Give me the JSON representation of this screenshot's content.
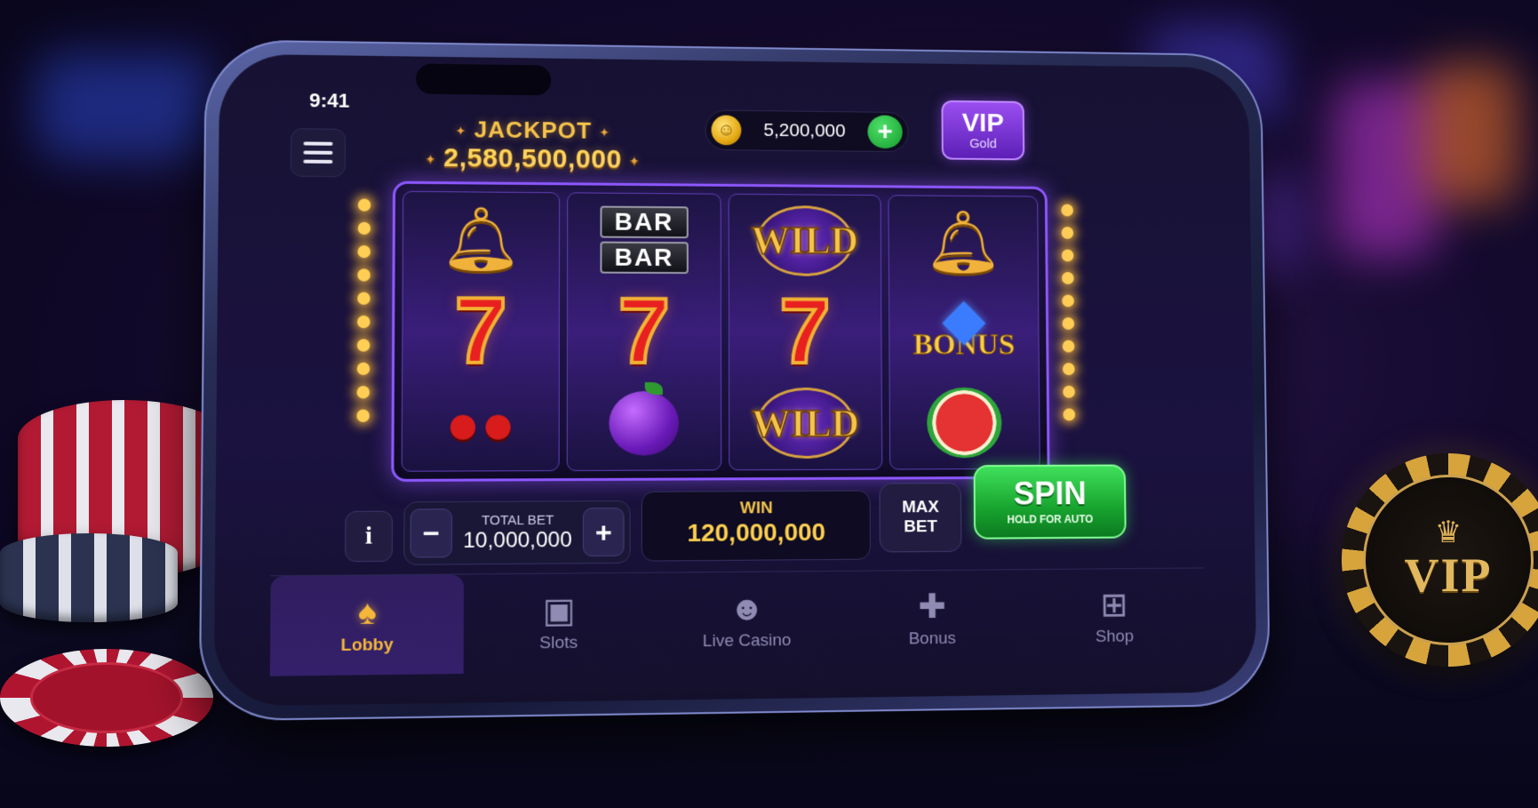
{
  "status_bar": {
    "time": "9:41"
  },
  "header": {
    "jackpot_label": "JACKPOT",
    "jackpot_value": "2,580,500,000",
    "coin_balance": "5,200,000",
    "coin_add_label": "+",
    "vip_label": "VIP",
    "vip_tier": "Gold"
  },
  "reels": [
    [
      "bell-icon",
      "seven-icon",
      "cherry-icon"
    ],
    [
      "bar-icon",
      "seven-icon",
      "plum-icon"
    ],
    [
      "wild-icon",
      "seven-icon",
      "wild-icon"
    ],
    [
      "bell-icon",
      "bonus-icon",
      "watermelon-icon"
    ]
  ],
  "symbol_text": {
    "bar": "BAR",
    "seven": "7",
    "wild": "WILD",
    "bonus": "BONUS"
  },
  "controls": {
    "info_label": "i",
    "minus_label": "−",
    "plus_label": "+",
    "total_bet_label": "TOTAL BET",
    "total_bet_value": "10,000,000",
    "win_label": "WIN",
    "win_value": "120,000,000",
    "max_bet_label": "MAX BET",
    "spin_label": "SPIN",
    "spin_sublabel": "HOLD FOR AUTO"
  },
  "nav": [
    {
      "label": "Lobby",
      "icon": "spade-icon",
      "active": true
    },
    {
      "label": "Slots",
      "icon": "slot-machine-icon",
      "active": false
    },
    {
      "label": "Live Casino",
      "icon": "dealer-icon",
      "active": false
    },
    {
      "label": "Bonus",
      "icon": "gift-icon",
      "active": false
    },
    {
      "label": "Shop",
      "icon": "cart-icon",
      "active": false
    }
  ],
  "props": {
    "vip_chip_text": "VIP"
  },
  "colors": {
    "accent_gold": "#f5c24a",
    "spin_green": "#17a32e",
    "frame_purple": "#8d57ff"
  }
}
